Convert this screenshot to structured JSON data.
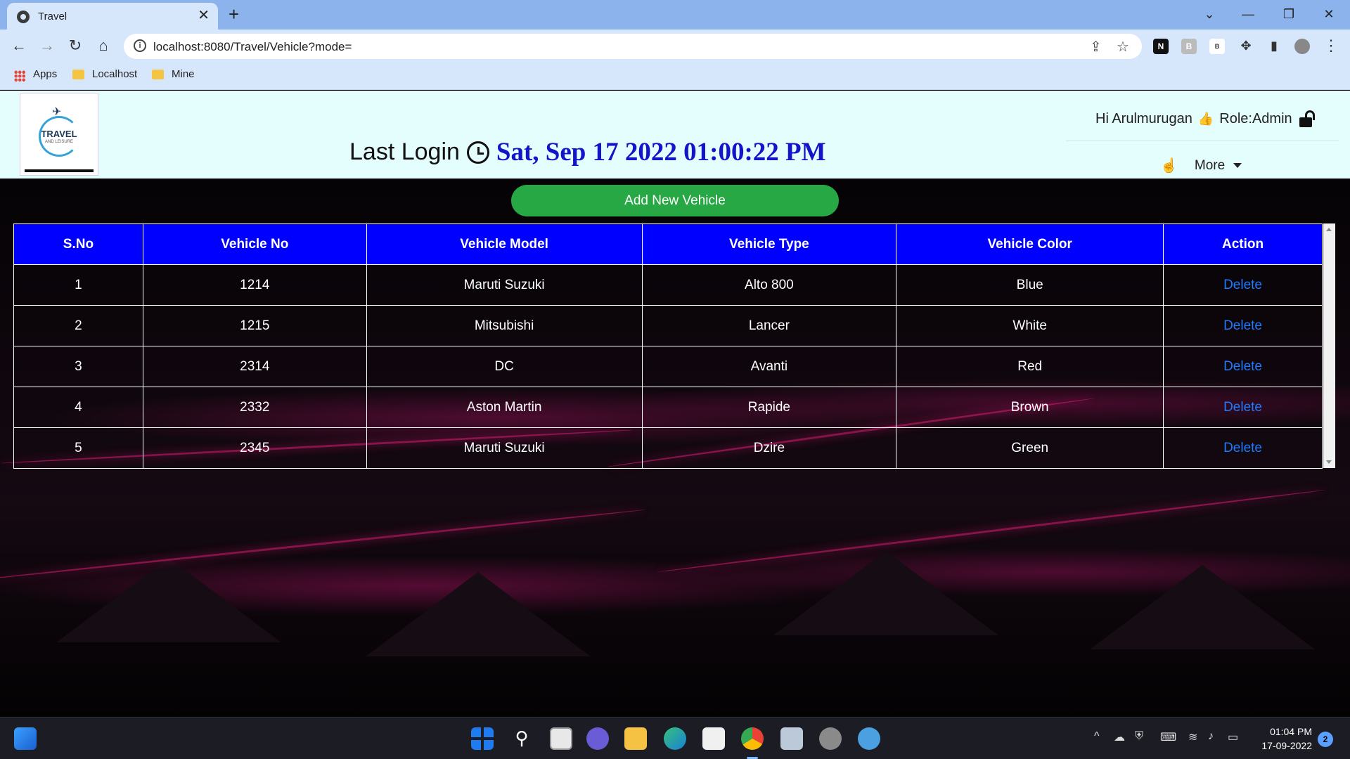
{
  "browser": {
    "tab_title": "Travel",
    "tab_close": "✕",
    "new_tab": "+",
    "url": "localhost:8080/Travel/Vehicle?mode=",
    "bookmarks": [
      "Apps",
      "Localhost",
      "Mine"
    ],
    "extensions": [
      "N",
      "B",
      "B"
    ]
  },
  "header": {
    "logo_text": "TRAVEL",
    "logo_sub": "AND LEISURE",
    "last_login_label": "Last Login",
    "last_login_time": "Sat, Sep 17 2022 01:00:22 PM",
    "greeting": "Hi Arulmurugan",
    "role": "Role:Admin",
    "more_label": "More"
  },
  "actions": {
    "add_vehicle_label": "Add New Vehicle"
  },
  "table": {
    "columns": [
      "S.No",
      "Vehicle No",
      "Vehicle Model",
      "Vehicle Type",
      "Vehicle Color",
      "Action"
    ],
    "rows": [
      {
        "sno": "1",
        "no": "1214",
        "model": "Maruti Suzuki",
        "type": "Alto 800",
        "color": "Blue",
        "action": "Delete"
      },
      {
        "sno": "2",
        "no": "1215",
        "model": "Mitsubishi",
        "type": "Lancer",
        "color": "White",
        "action": "Delete"
      },
      {
        "sno": "3",
        "no": "2314",
        "model": "DC",
        "type": "Avanti",
        "color": "Red",
        "action": "Delete"
      },
      {
        "sno": "4",
        "no": "2332",
        "model": "Aston Martin",
        "type": "Rapide",
        "color": "Brown",
        "action": "Delete"
      },
      {
        "sno": "5",
        "no": "2345",
        "model": "Maruti Suzuki",
        "type": "Dzire",
        "color": "Green",
        "action": "Delete"
      }
    ]
  },
  "taskbar": {
    "time": "01:04 PM",
    "date": "17-09-2022",
    "notifications": "2"
  },
  "colors": {
    "header_bg": "#e4fdfd",
    "table_header": "#0000ff",
    "add_button": "#28a745",
    "login_time": "#1414c8",
    "delete_link": "#1e7bff"
  }
}
